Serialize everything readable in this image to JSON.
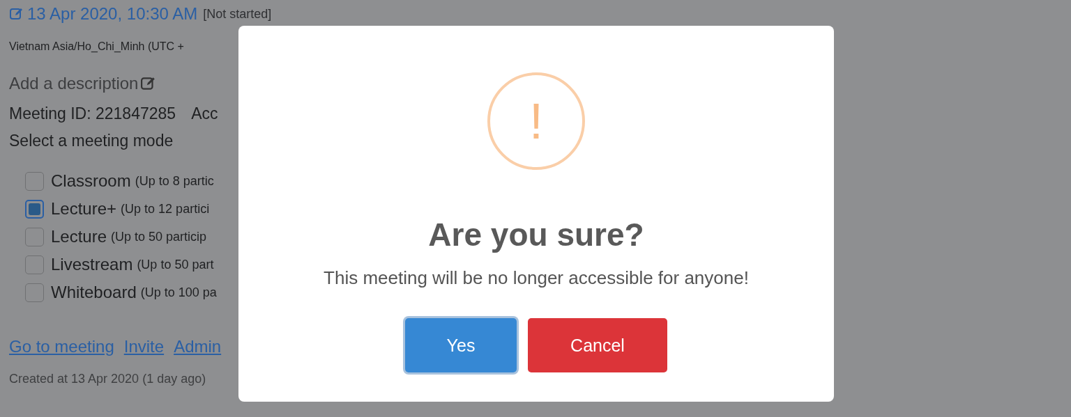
{
  "meeting": {
    "datetime": "13 Apr 2020, 10:30 AM",
    "status": "[Not started]",
    "timezone": "Vietnam Asia/Ho_Chi_Minh (UTC +",
    "description_placeholder": "Add a description",
    "meeting_id": "Meeting ID: 221847285",
    "meeting_id_extra": "Acc",
    "mode_heading": "Select a meeting mode",
    "modes": [
      {
        "label": "Classroom",
        "note": "(Up to 8 partic",
        "checked": false
      },
      {
        "label": "Lecture+",
        "note": "(Up to 12 partici",
        "checked": true
      },
      {
        "label": "Lecture",
        "note": "(Up to 50 particip",
        "checked": false
      },
      {
        "label": "Livestream",
        "note": "(Up to 50 part",
        "checked": false
      },
      {
        "label": "Whiteboard",
        "note": "(Up to 100 pa",
        "checked": false
      }
    ],
    "links": [
      "Go to meeting",
      "Invite",
      "Admin"
    ],
    "created": "Created at 13 Apr 2020 (1 day ago)"
  },
  "dialog": {
    "title": "Are you sure?",
    "message": "This meeting will be no longer accessible for anyone!",
    "icon_glyph": "!",
    "buttons": [
      {
        "label": "Yes",
        "kind": "confirm"
      },
      {
        "label": "Cancel",
        "kind": "cancel"
      }
    ]
  }
}
